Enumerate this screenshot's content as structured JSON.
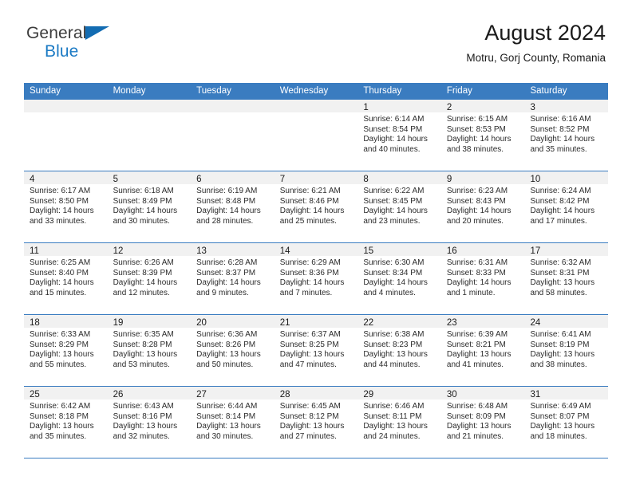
{
  "brand": {
    "name_part1": "General",
    "name_part2": "Blue",
    "colors": {
      "dark": "#3c3c3c",
      "blue": "#1b7ac4",
      "triangle": "#136cb2"
    }
  },
  "header": {
    "title": "August 2024",
    "subtitle": "Motru, Gorj County, Romania"
  },
  "theme": {
    "header_blue": "#3a7cc0",
    "daynum_band": "#f1f1f1",
    "text": "#2b2b2b"
  },
  "calendar": {
    "weekday_headers": [
      "Sunday",
      "Monday",
      "Tuesday",
      "Wednesday",
      "Thursday",
      "Friday",
      "Saturday"
    ],
    "labels": {
      "sunrise": "Sunrise:",
      "sunset": "Sunset:",
      "daylight": "Daylight:"
    },
    "weeks": [
      [
        {
          "day": "",
          "empty": true
        },
        {
          "day": "",
          "empty": true
        },
        {
          "day": "",
          "empty": true
        },
        {
          "day": "",
          "empty": true
        },
        {
          "day": "1",
          "sunrise": "Sunrise: 6:14 AM",
          "sunset": "Sunset: 8:54 PM",
          "daylight": "Daylight: 14 hours and 40 minutes."
        },
        {
          "day": "2",
          "sunrise": "Sunrise: 6:15 AM",
          "sunset": "Sunset: 8:53 PM",
          "daylight": "Daylight: 14 hours and 38 minutes."
        },
        {
          "day": "3",
          "sunrise": "Sunrise: 6:16 AM",
          "sunset": "Sunset: 8:52 PM",
          "daylight": "Daylight: 14 hours and 35 minutes."
        }
      ],
      [
        {
          "day": "4",
          "sunrise": "Sunrise: 6:17 AM",
          "sunset": "Sunset: 8:50 PM",
          "daylight": "Daylight: 14 hours and 33 minutes."
        },
        {
          "day": "5",
          "sunrise": "Sunrise: 6:18 AM",
          "sunset": "Sunset: 8:49 PM",
          "daylight": "Daylight: 14 hours and 30 minutes."
        },
        {
          "day": "6",
          "sunrise": "Sunrise: 6:19 AM",
          "sunset": "Sunset: 8:48 PM",
          "daylight": "Daylight: 14 hours and 28 minutes."
        },
        {
          "day": "7",
          "sunrise": "Sunrise: 6:21 AM",
          "sunset": "Sunset: 8:46 PM",
          "daylight": "Daylight: 14 hours and 25 minutes."
        },
        {
          "day": "8",
          "sunrise": "Sunrise: 6:22 AM",
          "sunset": "Sunset: 8:45 PM",
          "daylight": "Daylight: 14 hours and 23 minutes."
        },
        {
          "day": "9",
          "sunrise": "Sunrise: 6:23 AM",
          "sunset": "Sunset: 8:43 PM",
          "daylight": "Daylight: 14 hours and 20 minutes."
        },
        {
          "day": "10",
          "sunrise": "Sunrise: 6:24 AM",
          "sunset": "Sunset: 8:42 PM",
          "daylight": "Daylight: 14 hours and 17 minutes."
        }
      ],
      [
        {
          "day": "11",
          "sunrise": "Sunrise: 6:25 AM",
          "sunset": "Sunset: 8:40 PM",
          "daylight": "Daylight: 14 hours and 15 minutes."
        },
        {
          "day": "12",
          "sunrise": "Sunrise: 6:26 AM",
          "sunset": "Sunset: 8:39 PM",
          "daylight": "Daylight: 14 hours and 12 minutes."
        },
        {
          "day": "13",
          "sunrise": "Sunrise: 6:28 AM",
          "sunset": "Sunset: 8:37 PM",
          "daylight": "Daylight: 14 hours and 9 minutes."
        },
        {
          "day": "14",
          "sunrise": "Sunrise: 6:29 AM",
          "sunset": "Sunset: 8:36 PM",
          "daylight": "Daylight: 14 hours and 7 minutes."
        },
        {
          "day": "15",
          "sunrise": "Sunrise: 6:30 AM",
          "sunset": "Sunset: 8:34 PM",
          "daylight": "Daylight: 14 hours and 4 minutes."
        },
        {
          "day": "16",
          "sunrise": "Sunrise: 6:31 AM",
          "sunset": "Sunset: 8:33 PM",
          "daylight": "Daylight: 14 hours and 1 minute."
        },
        {
          "day": "17",
          "sunrise": "Sunrise: 6:32 AM",
          "sunset": "Sunset: 8:31 PM",
          "daylight": "Daylight: 13 hours and 58 minutes."
        }
      ],
      [
        {
          "day": "18",
          "sunrise": "Sunrise: 6:33 AM",
          "sunset": "Sunset: 8:29 PM",
          "daylight": "Daylight: 13 hours and 55 minutes."
        },
        {
          "day": "19",
          "sunrise": "Sunrise: 6:35 AM",
          "sunset": "Sunset: 8:28 PM",
          "daylight": "Daylight: 13 hours and 53 minutes."
        },
        {
          "day": "20",
          "sunrise": "Sunrise: 6:36 AM",
          "sunset": "Sunset: 8:26 PM",
          "daylight": "Daylight: 13 hours and 50 minutes."
        },
        {
          "day": "21",
          "sunrise": "Sunrise: 6:37 AM",
          "sunset": "Sunset: 8:25 PM",
          "daylight": "Daylight: 13 hours and 47 minutes."
        },
        {
          "day": "22",
          "sunrise": "Sunrise: 6:38 AM",
          "sunset": "Sunset: 8:23 PM",
          "daylight": "Daylight: 13 hours and 44 minutes."
        },
        {
          "day": "23",
          "sunrise": "Sunrise: 6:39 AM",
          "sunset": "Sunset: 8:21 PM",
          "daylight": "Daylight: 13 hours and 41 minutes."
        },
        {
          "day": "24",
          "sunrise": "Sunrise: 6:41 AM",
          "sunset": "Sunset: 8:19 PM",
          "daylight": "Daylight: 13 hours and 38 minutes."
        }
      ],
      [
        {
          "day": "25",
          "sunrise": "Sunrise: 6:42 AM",
          "sunset": "Sunset: 8:18 PM",
          "daylight": "Daylight: 13 hours and 35 minutes."
        },
        {
          "day": "26",
          "sunrise": "Sunrise: 6:43 AM",
          "sunset": "Sunset: 8:16 PM",
          "daylight": "Daylight: 13 hours and 32 minutes."
        },
        {
          "day": "27",
          "sunrise": "Sunrise: 6:44 AM",
          "sunset": "Sunset: 8:14 PM",
          "daylight": "Daylight: 13 hours and 30 minutes."
        },
        {
          "day": "28",
          "sunrise": "Sunrise: 6:45 AM",
          "sunset": "Sunset: 8:12 PM",
          "daylight": "Daylight: 13 hours and 27 minutes."
        },
        {
          "day": "29",
          "sunrise": "Sunrise: 6:46 AM",
          "sunset": "Sunset: 8:11 PM",
          "daylight": "Daylight: 13 hours and 24 minutes."
        },
        {
          "day": "30",
          "sunrise": "Sunrise: 6:48 AM",
          "sunset": "Sunset: 8:09 PM",
          "daylight": "Daylight: 13 hours and 21 minutes."
        },
        {
          "day": "31",
          "sunrise": "Sunrise: 6:49 AM",
          "sunset": "Sunset: 8:07 PM",
          "daylight": "Daylight: 13 hours and 18 minutes."
        }
      ]
    ]
  }
}
